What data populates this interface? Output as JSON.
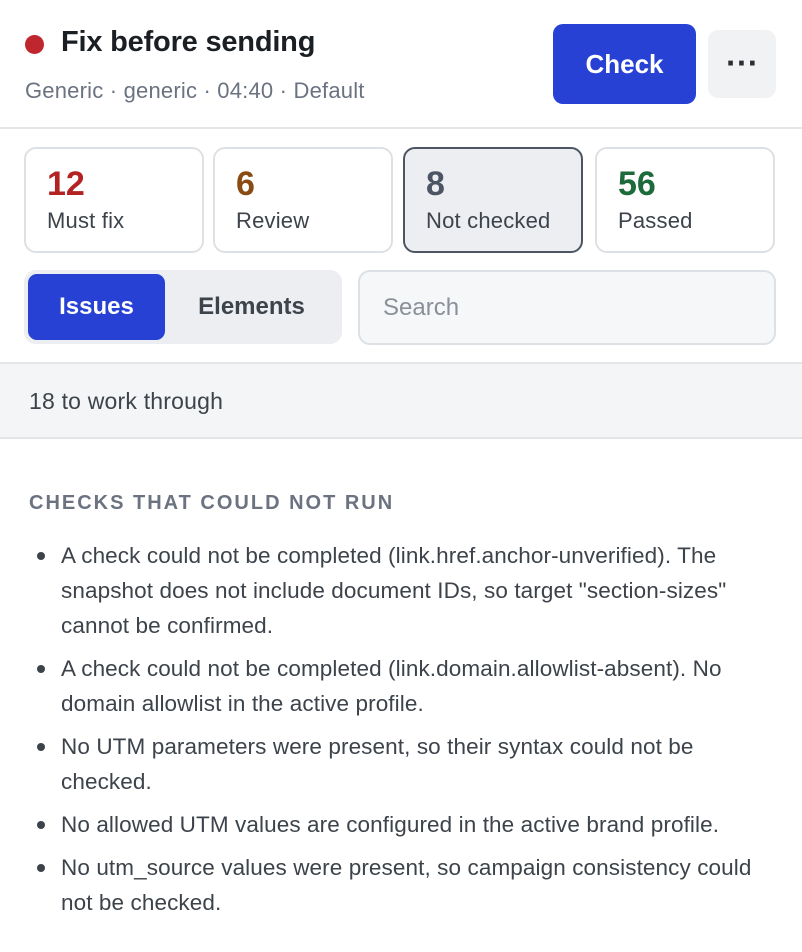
{
  "header": {
    "status_color": "#c0262d",
    "title": "Fix before sending",
    "meta": "Generic · generic · 04:40 · Default",
    "check_label": "Check",
    "more_label": "···"
  },
  "stats": [
    {
      "count": "12",
      "label": "Must fix",
      "color": "#b42323"
    },
    {
      "count": "6",
      "label": "Review",
      "color": "#8a4b12"
    },
    {
      "count": "8",
      "label": "Not checked",
      "color": "#4b5563"
    },
    {
      "count": "56",
      "label": "Passed",
      "color": "#1d6b3a"
    }
  ],
  "tabs": {
    "issues": "Issues",
    "elements": "Elements",
    "active": "Issues"
  },
  "search": {
    "placeholder": "Search",
    "value": ""
  },
  "summary": "18 to work through",
  "section": {
    "title": "CHECKS THAT COULD NOT RUN",
    "items": [
      "A check could not be completed (link.href.anchor-unverified). The snapshot does not include document IDs, so target \"section-sizes\" cannot be confirmed.",
      "A check could not be completed (link.domain.allowlist-absent). No domain allowlist in the active profile.",
      "No UTM parameters were present, so their syntax could not be checked.",
      "No allowed UTM values are configured in the active brand profile.",
      "No utm_source values were present, so campaign consistency could not be checked."
    ]
  },
  "colors": {
    "accent": "#2641d4",
    "must_fix": "#b42323",
    "review": "#8a4b12",
    "passed": "#1d6b3a"
  }
}
